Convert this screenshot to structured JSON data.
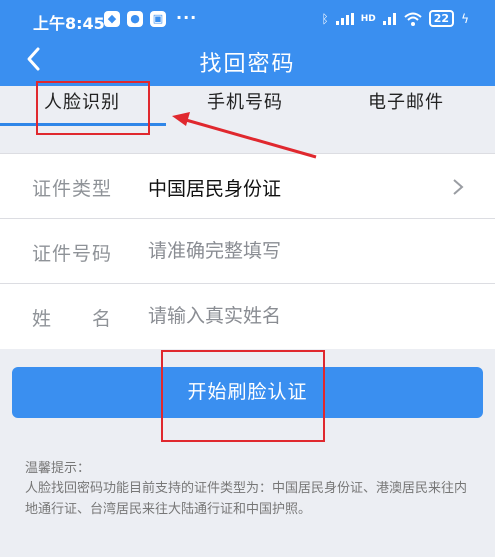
{
  "status_bar": {
    "time": "上午8:45",
    "app_icons": [
      "shield-icon",
      "security-icon",
      "app-icon"
    ],
    "more": "···",
    "network": "HD",
    "battery": "22"
  },
  "header": {
    "back_icon": "back-arrow-icon",
    "title": "找回密码"
  },
  "tabs": [
    {
      "label": "人脸识别",
      "active": true
    },
    {
      "label": "手机号码",
      "active": false
    },
    {
      "label": "电子邮件",
      "active": false
    }
  ],
  "form": {
    "id_type": {
      "label": "证件类型",
      "value": "中国居民身份证"
    },
    "id_number": {
      "label": "证件号码",
      "placeholder": "请准确完整填写"
    },
    "name": {
      "label": "姓　　名",
      "placeholder": "请输入真实姓名"
    }
  },
  "button": {
    "label": "开始刷脸认证"
  },
  "tip": {
    "title": "温馨提示：",
    "body": "人脸找回密码功能目前支持的证件类型为：中国居民身份证、港澳居民来往内地通行证、台湾居民来往大陆通行证和中国护照。"
  },
  "colors": {
    "accent": "#3a8ff0",
    "annotation": "#e0282e"
  }
}
